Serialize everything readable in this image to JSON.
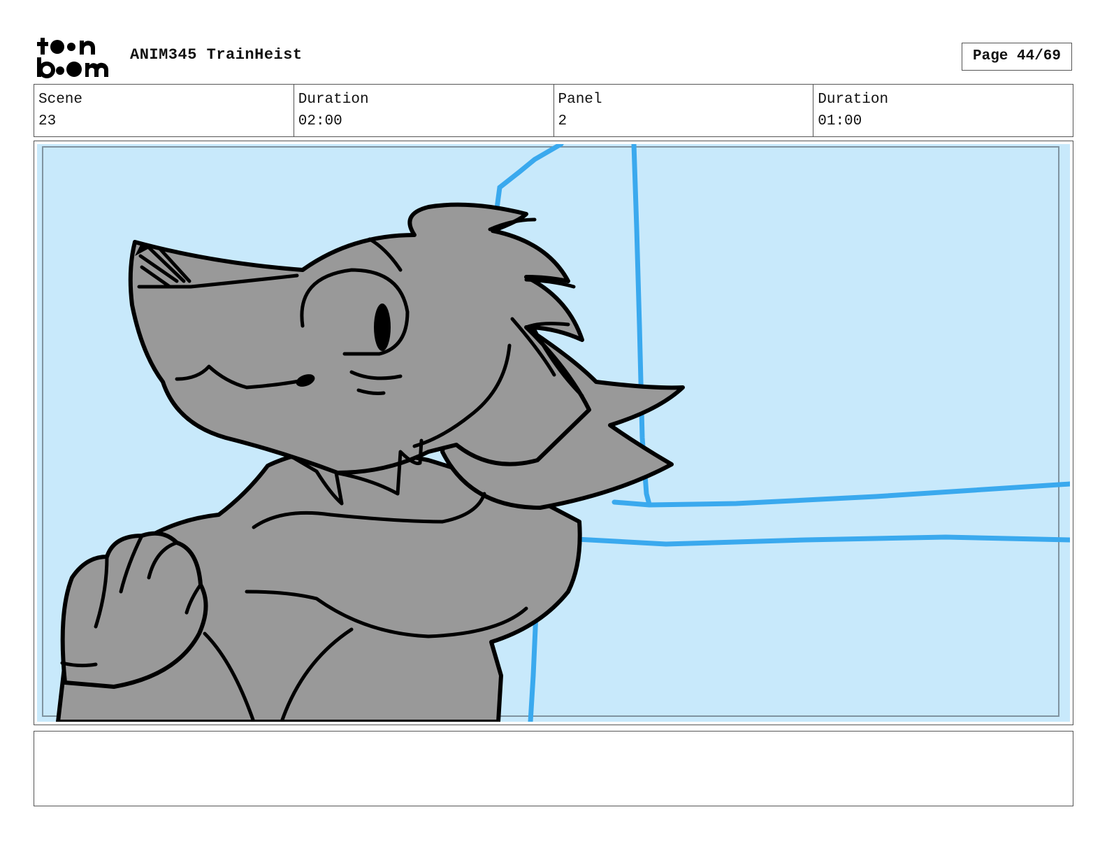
{
  "header": {
    "logo_text_top": "toon",
    "logo_text_bottom": "boom",
    "project_title": "ANIM345 TrainHeist",
    "page_label": "Page 44/69"
  },
  "info": [
    {
      "label": "Scene",
      "value": "23"
    },
    {
      "label": "Duration",
      "value": "02:00"
    },
    {
      "label": "Panel",
      "value": "2"
    },
    {
      "label": "Duration",
      "value": "01:00"
    }
  ],
  "panel": {
    "background_color": "#c8e9fb",
    "line_color": "#3aa9ee",
    "character_fill": "#999999",
    "outline_color": "#000000"
  },
  "notes": {
    "text": ""
  }
}
